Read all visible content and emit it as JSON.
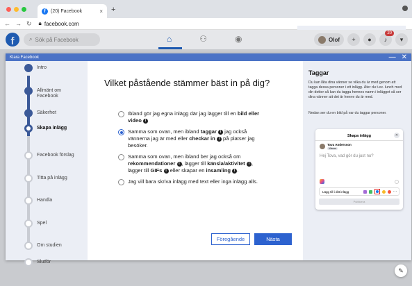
{
  "browser": {
    "tab_title": "(20) Facebook",
    "tab_close": "×",
    "new_tab": "+",
    "url": "facebook.com"
  },
  "facebook": {
    "search_placeholder": "Sök på Facebook",
    "user_name": "Olof",
    "notification_count": "20"
  },
  "dialog": {
    "header_title": "Klara Facebook",
    "minimize": "—",
    "close": "✕"
  },
  "sidebar": {
    "steps": [
      {
        "label": "Intro",
        "state": "done"
      },
      {
        "label": "Allmänt om Facebook",
        "state": "done"
      },
      {
        "label": "Säkerhet",
        "state": "done"
      },
      {
        "label": "Skapa inlägg",
        "state": "current"
      },
      {
        "label": "Facebook förslag",
        "state": "todo"
      },
      {
        "label": "Titta på inlägg",
        "state": "todo"
      },
      {
        "label": "Handla",
        "state": "todo"
      },
      {
        "label": "Spel",
        "state": "todo"
      },
      {
        "label": "Om studien",
        "state": "todo"
      },
      {
        "label": "Slutför",
        "state": "todo"
      }
    ]
  },
  "main": {
    "question": "Vilket påstående stämmer bäst in på dig?",
    "options": [
      {
        "parts": [
          [
            "Ibland gör jag egna inlägg där jag lägger till en ",
            0
          ],
          [
            "bild eller video",
            1
          ]
        ],
        "selected": false
      },
      {
        "parts": [
          [
            "Samma som ovan, men ibland ",
            0
          ],
          [
            "taggar",
            1
          ],
          [
            " jag också vännerna jag är med eller ",
            0
          ],
          [
            "checkar in",
            1
          ],
          [
            " på platser jag besöker.",
            0
          ]
        ],
        "selected": true
      },
      {
        "parts": [
          [
            "Samma som ovan, men ibland ber jag också om ",
            0
          ],
          [
            "rekommendationer",
            1
          ],
          [
            ", lägger till ",
            0
          ],
          [
            "känsla/aktivitet",
            1
          ],
          [
            ", lägger till ",
            0
          ],
          [
            "GIFs",
            1
          ],
          [
            " eller skapar en ",
            0
          ],
          [
            "insamling",
            1
          ],
          [
            ".",
            0
          ]
        ],
        "selected": false
      },
      {
        "parts": [
          [
            "Jag vill bara skriva inlägg med text eller inga inlägg alls.",
            0
          ]
        ],
        "selected": false
      }
    ],
    "prev_label": "Föregående",
    "next_label": "Nästa"
  },
  "help": {
    "title": "Taggar",
    "text1": "Du kan låta dina vänner se vilka du är med genom att tagga dessa personer i ett inlägg. Äter du t.ex. lunch med din dotter så kan du tagga hennes namn i inlägget så ser dina vänner att det är henne du är med.",
    "text2": "Nedan ser du en bild på var du taggar personer.",
    "card": {
      "title": "Skapa inlägg",
      "name": "Tova Andersson",
      "privacy": "Vänner",
      "placeholder": "Hej Tova, vad gör du just nu?",
      "add_label": "Lägg till i ditt inlägg",
      "publish": "Publicera"
    }
  },
  "colors": {
    "header_blue": "#4b73c6",
    "step_done": "#3b5998",
    "button_blue": "#2d62cf"
  }
}
